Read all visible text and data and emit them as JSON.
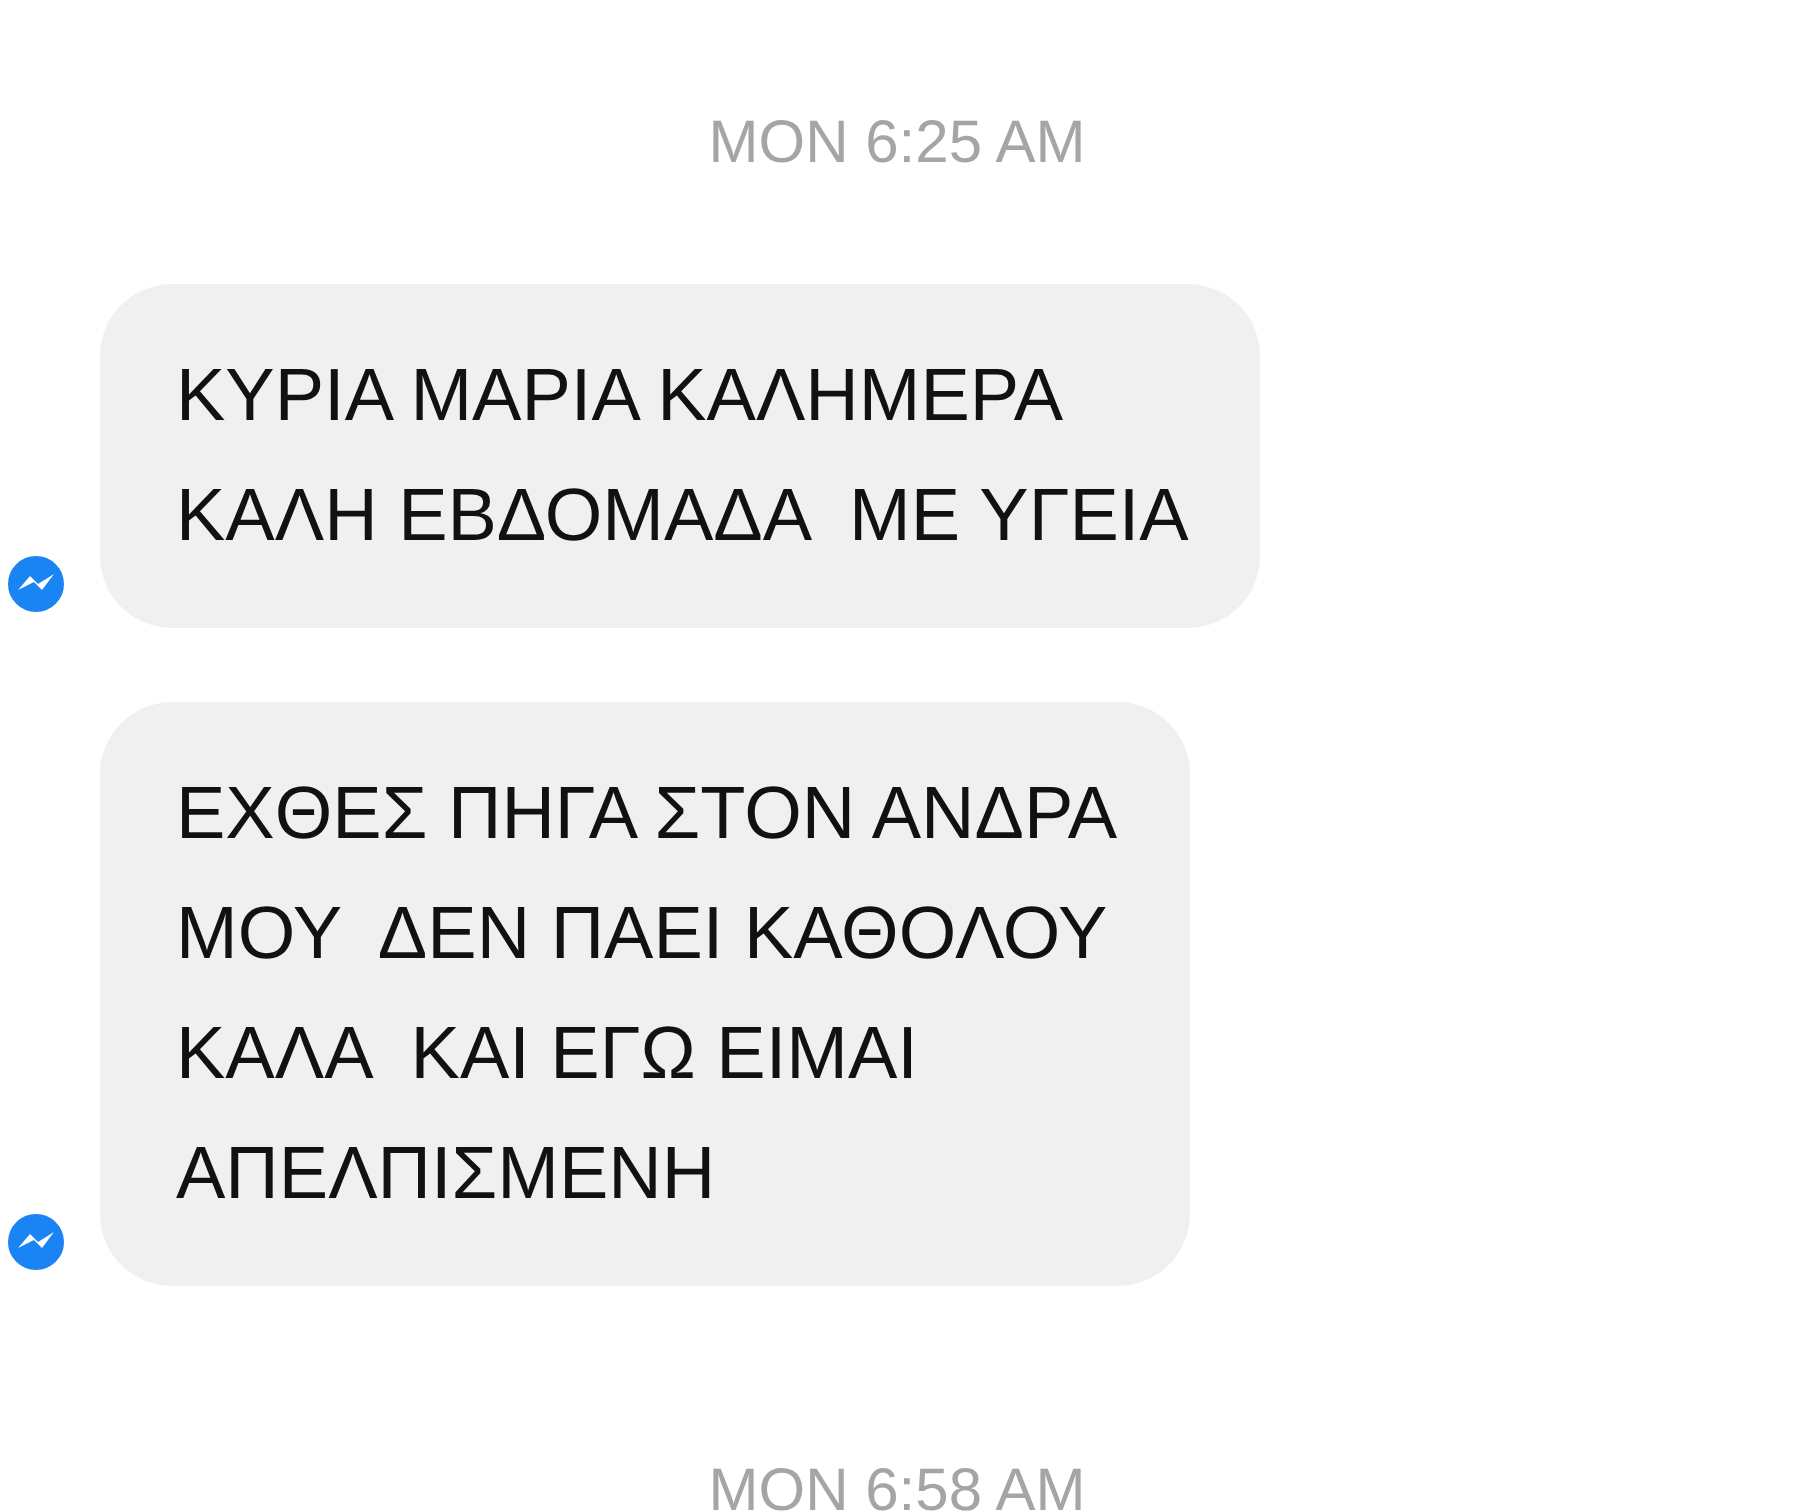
{
  "messages": [
    {
      "kind": "timestamp",
      "text": "MON 6:25 AM"
    },
    {
      "kind": "bubble",
      "lines": [
        "ΚΥΡΙΑ ΜΑΡΙΑ ΚΑΛΗΜΕΡΑ",
        "ΚΑΛΗ ΕΒΔΟΜΑΔΑ  ΜΕ ΥΓΕΙΑ"
      ]
    },
    {
      "kind": "bubble",
      "lines": [
        "ΕΧΘΕΣ ΠΗΓΑ ΣΤΟΝ ΑΝΔΡΑ",
        "ΜΟΥ  ΔΕΝ ΠΑΕΙ ΚΑΘΟΛΟΥ",
        "ΚΑΛΑ  ΚΑΙ ΕΓΩ ΕΙΜΑΙ",
        "ΑΠΕΛΠΙΣΜΕΝΗ"
      ]
    },
    {
      "kind": "timestamp",
      "text": "MON 6:58 AM"
    }
  ]
}
